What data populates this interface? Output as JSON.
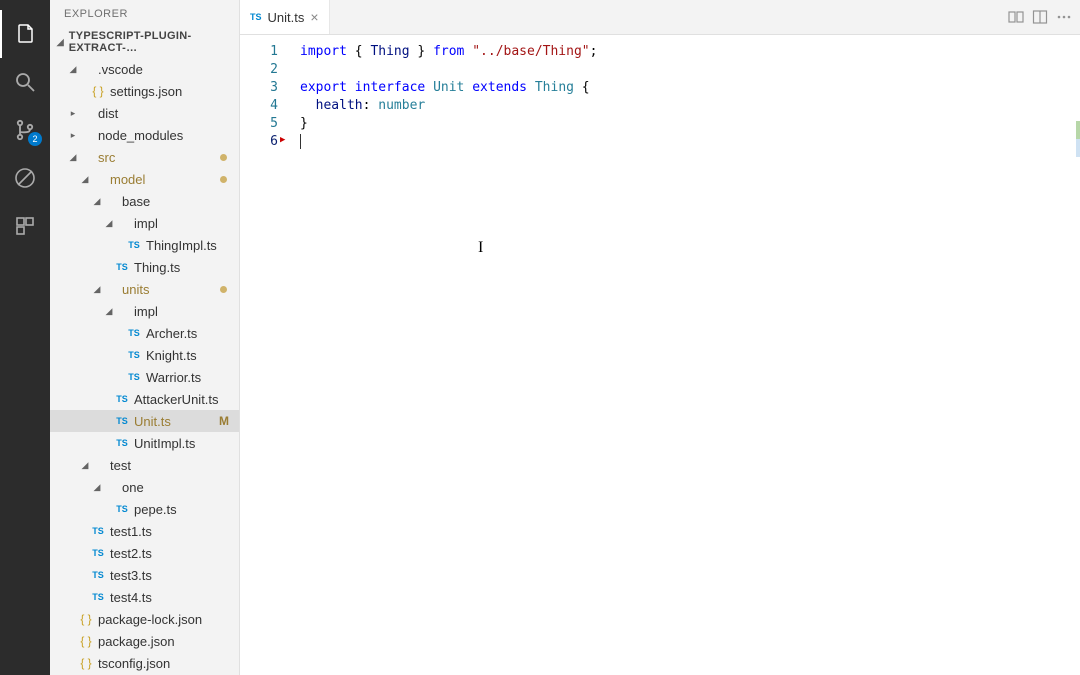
{
  "activity": {
    "scm_badge": "2"
  },
  "sidebar": {
    "title": "EXPLORER",
    "project": "TYPESCRIPT-PLUGIN-EXTRACT-…",
    "tree": [
      {
        "indent": 0,
        "kind": "folder",
        "label": ".vscode",
        "expanded": true
      },
      {
        "indent": 1,
        "kind": "json",
        "label": "settings.json"
      },
      {
        "indent": 0,
        "kind": "folder",
        "label": "dist",
        "expanded": false
      },
      {
        "indent": 0,
        "kind": "folder",
        "label": "node_modules",
        "expanded": false
      },
      {
        "indent": 0,
        "kind": "folder",
        "label": "src",
        "expanded": true,
        "modified": true,
        "dot": true
      },
      {
        "indent": 1,
        "kind": "folder",
        "label": "model",
        "expanded": true,
        "modified": true,
        "dot": true
      },
      {
        "indent": 2,
        "kind": "folder",
        "label": "base",
        "expanded": true
      },
      {
        "indent": 3,
        "kind": "folder",
        "label": "impl",
        "expanded": true
      },
      {
        "indent": 4,
        "kind": "ts",
        "label": "ThingImpl.ts"
      },
      {
        "indent": 3,
        "kind": "ts",
        "label": "Thing.ts"
      },
      {
        "indent": 2,
        "kind": "folder",
        "label": "units",
        "expanded": true,
        "modified": true,
        "dot": true
      },
      {
        "indent": 3,
        "kind": "folder",
        "label": "impl",
        "expanded": true
      },
      {
        "indent": 4,
        "kind": "ts",
        "label": "Archer.ts"
      },
      {
        "indent": 4,
        "kind": "ts",
        "label": "Knight.ts"
      },
      {
        "indent": 4,
        "kind": "ts",
        "label": "Warrior.ts"
      },
      {
        "indent": 3,
        "kind": "ts",
        "label": "AttackerUnit.ts"
      },
      {
        "indent": 3,
        "kind": "ts",
        "label": "Unit.ts",
        "status": "M",
        "selected": true,
        "modified": true
      },
      {
        "indent": 3,
        "kind": "ts",
        "label": "UnitImpl.ts"
      },
      {
        "indent": 1,
        "kind": "folder",
        "label": "test",
        "expanded": true
      },
      {
        "indent": 2,
        "kind": "folder",
        "label": "one",
        "expanded": true
      },
      {
        "indent": 3,
        "kind": "ts",
        "label": "pepe.ts"
      },
      {
        "indent": 1,
        "kind": "ts",
        "label": "test1.ts"
      },
      {
        "indent": 1,
        "kind": "ts",
        "label": "test2.ts"
      },
      {
        "indent": 1,
        "kind": "ts",
        "label": "test3.ts"
      },
      {
        "indent": 1,
        "kind": "ts",
        "label": "test4.ts"
      },
      {
        "indent": 0,
        "kind": "json",
        "label": "package-lock.json"
      },
      {
        "indent": 0,
        "kind": "json",
        "label": "package.json"
      },
      {
        "indent": 0,
        "kind": "json",
        "label": "tsconfig.json"
      }
    ]
  },
  "tabs": {
    "open": {
      "icon": "TS",
      "label": "Unit.ts"
    }
  },
  "editor": {
    "lines": [
      [
        {
          "t": "k",
          "v": "import"
        },
        {
          "t": "p",
          "v": " { "
        },
        {
          "t": "n",
          "v": "Thing"
        },
        {
          "t": "p",
          "v": " } "
        },
        {
          "t": "k",
          "v": "from"
        },
        {
          "t": "p",
          "v": " "
        },
        {
          "t": "s",
          "v": "\"../base/Thing\""
        },
        {
          "t": "p",
          "v": ";"
        }
      ],
      [],
      [
        {
          "t": "k",
          "v": "export"
        },
        {
          "t": "p",
          "v": " "
        },
        {
          "t": "k",
          "v": "interface"
        },
        {
          "t": "p",
          "v": " "
        },
        {
          "t": "t",
          "v": "Unit"
        },
        {
          "t": "p",
          "v": " "
        },
        {
          "t": "k",
          "v": "extends"
        },
        {
          "t": "p",
          "v": " "
        },
        {
          "t": "t",
          "v": "Thing"
        },
        {
          "t": "p",
          "v": " {"
        }
      ],
      [
        {
          "t": "p",
          "v": "  "
        },
        {
          "t": "n",
          "v": "health"
        },
        {
          "t": "p",
          "v": ": "
        },
        {
          "t": "t",
          "v": "number"
        }
      ],
      [
        {
          "t": "p",
          "v": "}"
        }
      ],
      []
    ],
    "active_line": 6
  }
}
